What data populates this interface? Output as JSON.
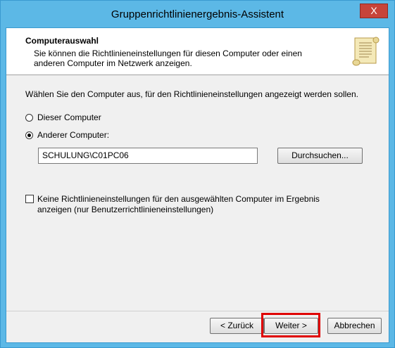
{
  "window": {
    "title": "Gruppenrichtlinienergebnis-Assistent",
    "close_glyph": "X"
  },
  "header": {
    "title": "Computerauswahl",
    "description": "Sie können die Richtlinieneinstellungen für diesen Computer oder einen anderen Computer im Netzwerk anzeigen.",
    "icon": "scroll-document-icon"
  },
  "body": {
    "prompt": "Wählen Sie den Computer aus, für den Richtlinieneinstellungen angezeigt werden sollen.",
    "radio_options": [
      {
        "label": "Dieser Computer",
        "selected": false
      },
      {
        "label": "Anderer Computer:",
        "selected": true
      }
    ],
    "computer_name": "SCHULUNG\\C01PC06",
    "browse_label": "Durchsuchen...",
    "checkbox_label": "Keine Richtlinieneinstellungen für den ausgewählten Computer im Ergebnis anzeigen (nur Benutzerrichtlinieneinstellungen)",
    "checkbox_checked": false
  },
  "footer": {
    "back_label": "< Zurück",
    "next_label": "Weiter >",
    "cancel_label": "Abbrechen"
  },
  "colors": {
    "frame": "#5cb8e6",
    "close": "#c7443a",
    "highlight": "#e00000"
  }
}
